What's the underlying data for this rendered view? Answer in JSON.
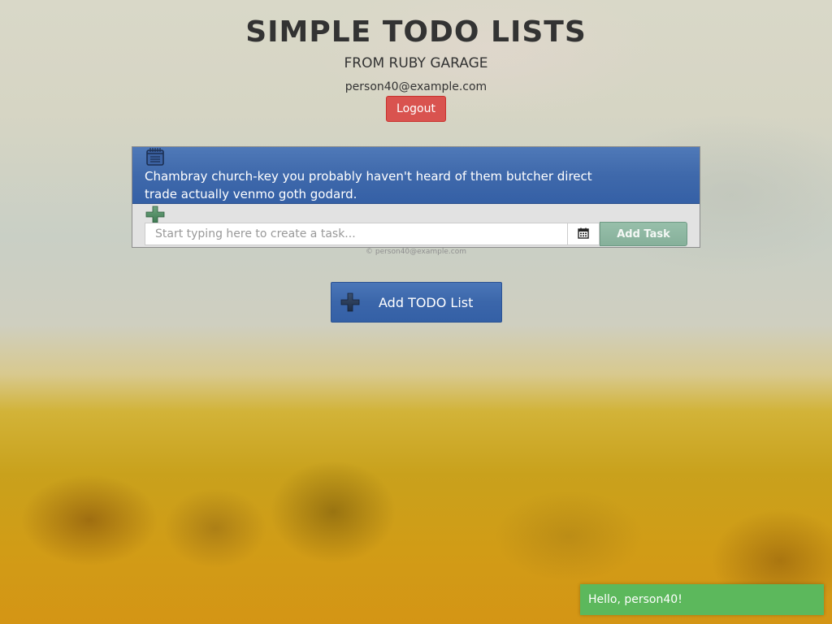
{
  "header": {
    "title": "SIMPLE TODO LISTS",
    "subtitle": "FROM RUBY GARAGE",
    "user_email": "person40@example.com",
    "logout_label": "Logout"
  },
  "todo_list": {
    "title": "Chambray church-key you probably haven't heard of them butcher direct trade actually venmo goth godard.",
    "task_placeholder": "Start typing here to create a task...",
    "task_value": "",
    "add_task_label": "Add Task",
    "icons": {
      "list": "notepad-icon",
      "add": "plus-icon",
      "date": "calendar-icon"
    }
  },
  "footer": {
    "copyright": "© person40@example.com"
  },
  "add_list": {
    "label": "Add TODO List",
    "icon": "plus-icon"
  },
  "toast": {
    "message": "Hello, person40!"
  },
  "colors": {
    "logout": "#d9534f",
    "panel_header": "#3f69ab",
    "add_task": "#86b09a",
    "toast": "#5cb85c"
  }
}
